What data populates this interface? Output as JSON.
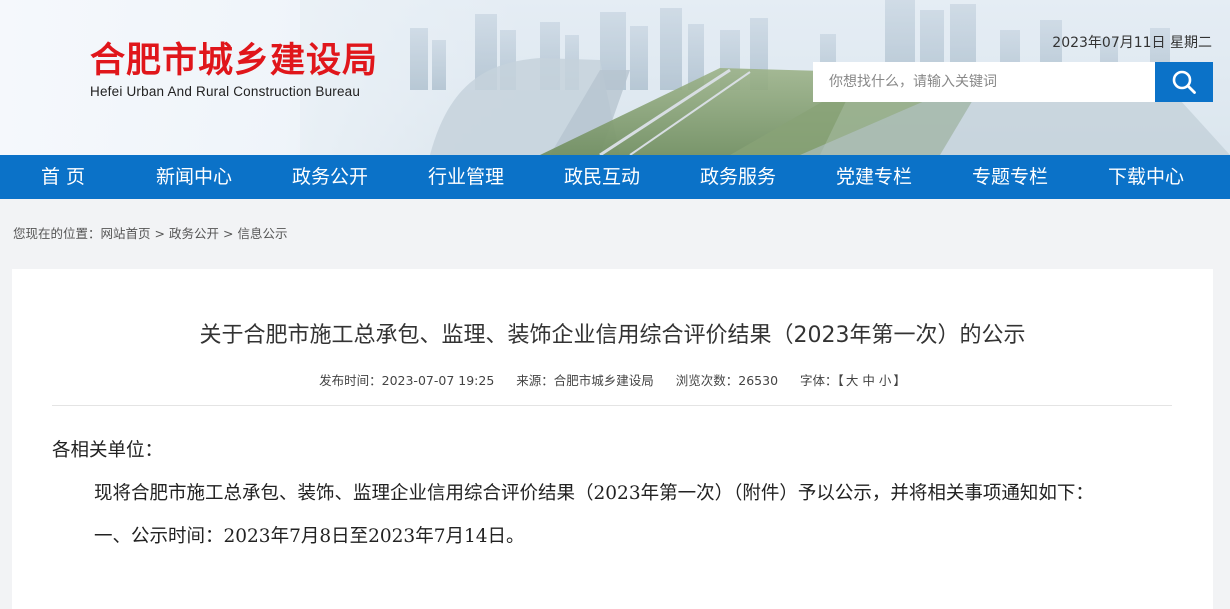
{
  "site": {
    "name_cn": "合肥市城乡建设局",
    "name_en": "Hefei Urban And Rural Construction Bureau",
    "date": "2023年07月11日 星期二"
  },
  "search": {
    "placeholder": "你想找什么，请输入关键词",
    "icon": "search-icon"
  },
  "nav": [
    "首 页",
    "新闻中心",
    "政务公开",
    "行业管理",
    "政民互动",
    "政务服务",
    "党建专栏",
    "专题专栏",
    "下载中心"
  ],
  "breadcrumb": {
    "prefix": "您现在的位置：",
    "items": [
      "网站首页",
      "政务公开",
      "信息公示"
    ],
    "separator": ">"
  },
  "article": {
    "title": "关于合肥市施工总承包、监理、装饰企业信用综合评价结果（2023年第一次）的公示",
    "meta": {
      "publish_label": "发布时间：",
      "publish_time": "2023-07-07 19:25",
      "source_label": "来源：",
      "source": "合肥市城乡建设局",
      "views_label": "浏览次数：",
      "views": "26530",
      "font_label": "字体：",
      "font_open": "【",
      "font_large": "大",
      "font_medium": "中",
      "font_small": "小",
      "font_close": "】"
    },
    "salutation": "各相关单位：",
    "paragraph1": "现将合肥市施工总承包、装饰、监理企业信用综合评价结果（2023年第一次）（附件）予以公示，并将相关事项通知如下：",
    "paragraph2": "一、公示时间：2023年7月8日至2023年7月14日。"
  },
  "colors": {
    "brand_red": "#e0161b",
    "nav_blue": "#0b72c8"
  }
}
